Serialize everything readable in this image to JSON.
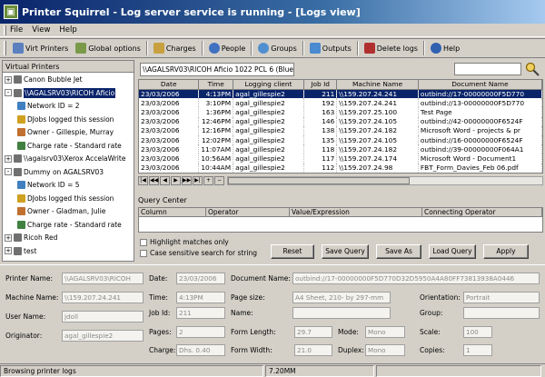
{
  "window": {
    "title": "Printer Squirrel - Log server service is running - [Logs view]"
  },
  "menu": [
    "File",
    "View",
    "Help"
  ],
  "toolbar": [
    {
      "label": "Virt Printers",
      "color": "#5b7fbf"
    },
    {
      "label": "Global options",
      "color": "#7a9a4a"
    },
    {
      "label": "Charges",
      "color": "#c8a040"
    },
    {
      "label": "People",
      "color": "#4070c0"
    },
    {
      "label": "Groups",
      "color": "#5090d0"
    },
    {
      "label": "Outputs",
      "color": "#4a8ad0"
    },
    {
      "label": "Delete logs",
      "color": "#b03030"
    },
    {
      "label": "Help",
      "color": "#3060b0"
    }
  ],
  "sidebar": {
    "header": "Virtual Printers",
    "nodes": [
      {
        "label": "Canon Bubble Jet",
        "level": 0,
        "expander": "+",
        "icon": "printer-icon"
      },
      {
        "label": "\\\\AGALSRV03\\RICOH Aficio",
        "level": 0,
        "expander": "-",
        "icon": "printer-icon",
        "selected": true
      },
      {
        "label": "Network ID = 2",
        "level": 1,
        "expander": "",
        "icon": "network-icon"
      },
      {
        "label": "DJobs logged this session",
        "level": 1,
        "expander": "",
        "icon": "document-icon"
      },
      {
        "label": "Owner - Gillespie, Murray",
        "level": 1,
        "expander": "",
        "icon": "owner-icon"
      },
      {
        "label": "Charge rate - Standard rate",
        "level": 1,
        "expander": "",
        "icon": "charge-icon"
      },
      {
        "label": "\\\\agalsrv03\\Xerox AccelaWrite",
        "level": 0,
        "expander": "+",
        "icon": "printer-icon"
      },
      {
        "label": "Dummy on AGALSRV03",
        "level": 0,
        "expander": "-",
        "icon": "printer-icon"
      },
      {
        "label": "Network ID = 5",
        "level": 1,
        "expander": "",
        "icon": "network-icon"
      },
      {
        "label": "DJobs logged this session",
        "level": 1,
        "expander": "",
        "icon": "document-icon"
      },
      {
        "label": "Owner - Gladman, Julie",
        "level": 1,
        "expander": "",
        "icon": "owner-icon"
      },
      {
        "label": "Charge rate - Standard rate",
        "level": 1,
        "expander": "",
        "icon": "charge-icon"
      },
      {
        "label": "Ricoh Red",
        "level": 0,
        "expander": "+",
        "icon": "printer-icon"
      },
      {
        "label": "test",
        "level": 0,
        "expander": "+",
        "icon": "printer-icon"
      }
    ]
  },
  "address": "\\\\AGALSRV03\\RICOH Aficio 1022 PCL 6 (Blue)",
  "logs": {
    "columns": [
      "Date",
      "Time",
      "Logging client",
      "Job Id",
      "Machine Name",
      "Document Name"
    ],
    "rows": [
      [
        "23/03/2006",
        "4:13PM",
        "agal_gillespie2",
        "211",
        "\\\\159.207.24.241",
        "outbind://17-00000000F5D770"
      ],
      [
        "23/03/2006",
        "3:10PM",
        "agal_gillespie2",
        "192",
        "\\\\159.207.24.241",
        "outbind://13-00000000F5D770"
      ],
      [
        "23/03/2006",
        "1:36PM",
        "agal_gillespie2",
        "163",
        "\\\\159.207.25.100",
        "Test Page"
      ],
      [
        "23/03/2006",
        "12:46PM",
        "agal_gillespie2",
        "146",
        "\\\\159.207.24.105",
        "outbind://42-00000000F6524F"
      ],
      [
        "23/03/2006",
        "12:16PM",
        "agal_gillespie2",
        "138",
        "\\\\159.207.24.182",
        "Microsoft Word - projects & pr"
      ],
      [
        "23/03/2006",
        "12:02PM",
        "agal_gillespie2",
        "135",
        "\\\\159.207.24.105",
        "outbind://16-00000000F6524F"
      ],
      [
        "23/03/2006",
        "11:07AM",
        "agal_gillespie2",
        "118",
        "\\\\159.207.24.182",
        "outbind://39-00000000F064A1"
      ],
      [
        "23/03/2006",
        "10:56AM",
        "agal_gillespie2",
        "117",
        "\\\\159.207.24.174",
        "Microsoft Word - Document1"
      ],
      [
        "23/03/2006",
        "10:44AM",
        "agal_gillespie2",
        "112",
        "\\\\159.207.24.98",
        "FBT_Form_Davies_Feb 06.pdf"
      ]
    ]
  },
  "query": {
    "title": "Query Center",
    "columns": [
      "Column",
      "Operator",
      "Value/Expression",
      "Connecting Operator"
    ],
    "highlight_label": "Highlight matches only",
    "case_label": "Case sensitive search for string",
    "buttons": [
      "Reset",
      "Save Query",
      "Save As",
      "Load Query",
      "Apply"
    ]
  },
  "details": {
    "printer_name": {
      "label": "Printer Name:",
      "value": "\\\\AGALSRV03\\RICOH"
    },
    "machine_name": {
      "label": "Machine Name:",
      "value": "\\\\159.207.24.241"
    },
    "user_name": {
      "label": "User Name:",
      "value": "jdoll"
    },
    "originator": {
      "label": "Originator:",
      "value": "agal_gillespie2"
    },
    "date": {
      "label": "Date:",
      "value": "23/03/2006"
    },
    "time": {
      "label": "Time:",
      "value": "4:13PM"
    },
    "job_id": {
      "label": "Job Id:",
      "value": "211"
    },
    "pages": {
      "label": "Pages:",
      "value": "2"
    },
    "charge": {
      "label": "Charge:",
      "value": "Dhs. 0.40"
    },
    "document_name": {
      "label": "Document Name:",
      "value": "outbind://17-00000000F5D770D32D5950A4A80FF73813938A0446"
    },
    "page_size": {
      "label": "Page size:",
      "value": "A4 Sheet, 210- by 297-mm"
    },
    "name": {
      "label": "Name:",
      "value": ""
    },
    "form_length": {
      "label": "Form Length:",
      "value": "29.7"
    },
    "form_width": {
      "label": "Form Width:",
      "value": "21.0"
    },
    "mode": {
      "label": "Mode:",
      "value": "Mono"
    },
    "duplex": {
      "label": "Duplex:",
      "value": "Mono"
    },
    "orientation": {
      "label": "Orientation:",
      "value": "Portrait"
    },
    "group": {
      "label": "Group:",
      "value": ""
    },
    "scale": {
      "label": "Scale:",
      "value": "100"
    },
    "copies": {
      "label": "Copies:",
      "value": "1"
    }
  },
  "status": {
    "text": "Browsing printer logs",
    "memory": "7.20MM"
  }
}
